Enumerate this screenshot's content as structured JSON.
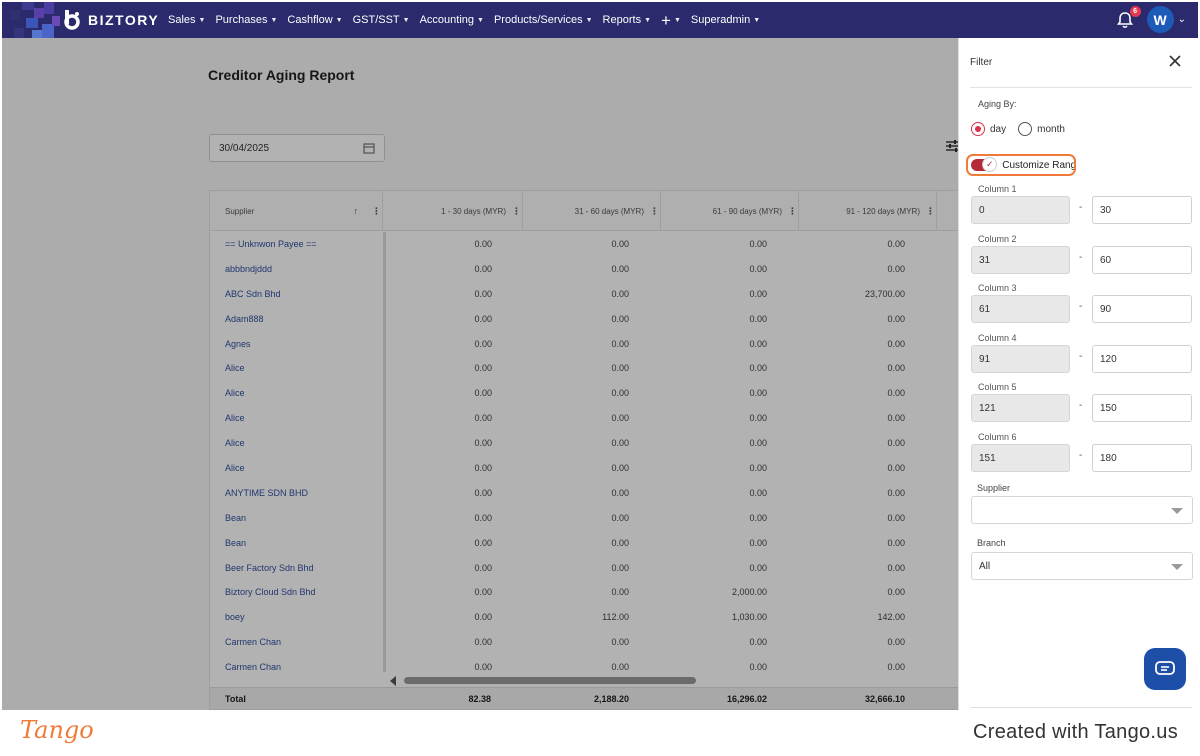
{
  "nav": {
    "brand": "BIZTORY",
    "menu": [
      {
        "label": "Sales",
        "has_caret": true
      },
      {
        "label": "Purchases",
        "has_caret": true
      },
      {
        "label": "Cashflow",
        "has_caret": true
      },
      {
        "label": "GST/SST",
        "has_caret": true
      },
      {
        "label": "Accounting",
        "has_caret": true
      },
      {
        "label": "Products/Services",
        "has_caret": true
      },
      {
        "label": "Reports",
        "has_caret": true
      },
      {
        "label": "+",
        "has_caret": true
      },
      {
        "label": "Superadmin",
        "has_caret": true
      }
    ],
    "notification_count": "6",
    "avatar_letter": "W"
  },
  "page": {
    "title": "Creditor Aging Report",
    "date_value": "30/04/2025"
  },
  "table": {
    "columns": [
      "Supplier",
      "1 - 30 days (MYR)",
      "31 - 60 days (MYR)",
      "61 - 90 days (MYR)",
      "91 - 120 days (MYR)"
    ],
    "rows": [
      [
        "== Unknwon Payee ==",
        "0.00",
        "0.00",
        "0.00",
        "0.00"
      ],
      [
        "abbbndjddd",
        "0.00",
        "0.00",
        "0.00",
        "0.00"
      ],
      [
        "ABC Sdn Bhd",
        "0.00",
        "0.00",
        "0.00",
        "23,700.00"
      ],
      [
        "Adam888",
        "0.00",
        "0.00",
        "0.00",
        "0.00"
      ],
      [
        "Agnes",
        "0.00",
        "0.00",
        "0.00",
        "0.00"
      ],
      [
        "Alice",
        "0.00",
        "0.00",
        "0.00",
        "0.00"
      ],
      [
        "Alice",
        "0.00",
        "0.00",
        "0.00",
        "0.00"
      ],
      [
        "Alice",
        "0.00",
        "0.00",
        "0.00",
        "0.00"
      ],
      [
        "Alice",
        "0.00",
        "0.00",
        "0.00",
        "0.00"
      ],
      [
        "Alice",
        "0.00",
        "0.00",
        "0.00",
        "0.00"
      ],
      [
        "ANYTIME SDN BHD",
        "0.00",
        "0.00",
        "0.00",
        "0.00"
      ],
      [
        "Bean",
        "0.00",
        "0.00",
        "0.00",
        "0.00"
      ],
      [
        "Bean",
        "0.00",
        "0.00",
        "0.00",
        "0.00"
      ],
      [
        "Beer Factory Sdn Bhd",
        "0.00",
        "0.00",
        "0.00",
        "0.00"
      ],
      [
        "Biztory Cloud Sdn Bhd",
        "0.00",
        "0.00",
        "2,000.00",
        "0.00"
      ],
      [
        "boey",
        "0.00",
        "112.00",
        "1,030.00",
        "142.00"
      ],
      [
        "Carmen Chan",
        "0.00",
        "0.00",
        "0.00",
        "0.00"
      ],
      [
        "Carmen Chan",
        "0.00",
        "0.00",
        "0.00",
        "0.00"
      ]
    ],
    "total": [
      "Total",
      "82.38",
      "2,188.20",
      "16,296.02",
      "32,666.10"
    ]
  },
  "filter": {
    "title": "Filter",
    "aging_by_label": "Aging By:",
    "aging_options": [
      {
        "label": "day",
        "selected": true
      },
      {
        "label": "month",
        "selected": false
      }
    ],
    "customize_range_label": "Customize Range",
    "customize_range_on": true,
    "ranges": [
      {
        "label": "Column 1",
        "from": "0",
        "to": "30"
      },
      {
        "label": "Column 2",
        "from": "31",
        "to": "60"
      },
      {
        "label": "Column 3",
        "from": "61",
        "to": "90"
      },
      {
        "label": "Column 4",
        "from": "91",
        "to": "120"
      },
      {
        "label": "Column 5",
        "from": "121",
        "to": "150"
      },
      {
        "label": "Column 6",
        "from": "151",
        "to": "180"
      }
    ],
    "range_separator": "-",
    "supplier_label": "Supplier",
    "supplier_value": "",
    "branch_label": "Branch",
    "branch_value": "All"
  },
  "footer": {
    "logo_text": "Tango",
    "credit_text": "Created with Tango.us"
  },
  "colors": {
    "nav_bg": "#2a2a6c",
    "accent_red": "#d9324a",
    "highlight_orange": "#f07a3a",
    "chat_blue": "#1d4ea8",
    "link_blue": "#2f4f9e"
  }
}
